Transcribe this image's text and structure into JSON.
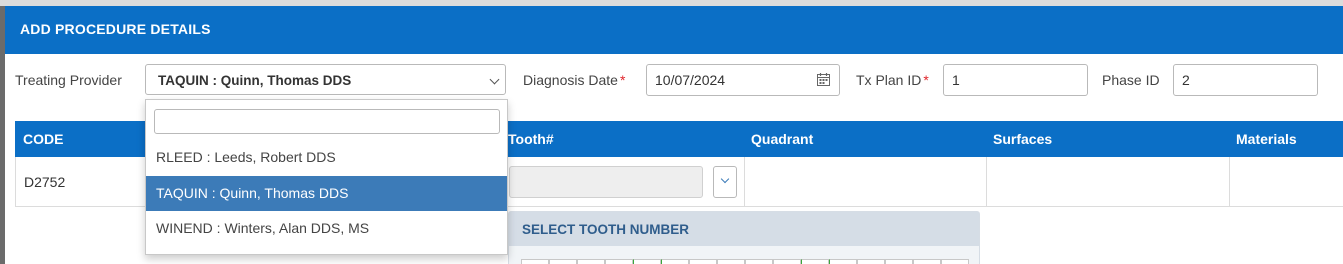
{
  "modal": {
    "title": "ADD PROCEDURE DETAILS"
  },
  "form": {
    "treating_provider": {
      "label": "Treating Provider",
      "value": "TAQUIN : Quinn, Thomas DDS"
    },
    "diagnosis_date": {
      "label": "Diagnosis Date",
      "required_mark": "*",
      "value": "10/07/2024"
    },
    "tx_plan_id": {
      "label": "Tx Plan ID",
      "required_mark": "*",
      "value": "1"
    },
    "phase_id": {
      "label": "Phase ID",
      "value": "2"
    }
  },
  "provider_dropdown": {
    "search_value": "",
    "options": [
      {
        "label": "RLEED : Leeds, Robert DDS",
        "selected": false
      },
      {
        "label": "TAQUIN : Quinn, Thomas DDS",
        "selected": true
      },
      {
        "label": "WINEND : Winters, Alan DDS, MS",
        "selected": false
      }
    ]
  },
  "table": {
    "columns": [
      "CODE",
      "Tooth#",
      "Quadrant",
      "Surfaces",
      "Materials"
    ],
    "rows": [
      {
        "code": "D2752",
        "tooth": "",
        "quadrant": "",
        "surfaces": "",
        "materials": ""
      }
    ]
  },
  "tooth_selector": {
    "title": "SELECT TOOTH NUMBER"
  },
  "colors": {
    "primary": "#0b6fc6",
    "selected_option": "#3c7bb8",
    "required": "#e0242a",
    "panel_title": "#2f5d8c"
  }
}
